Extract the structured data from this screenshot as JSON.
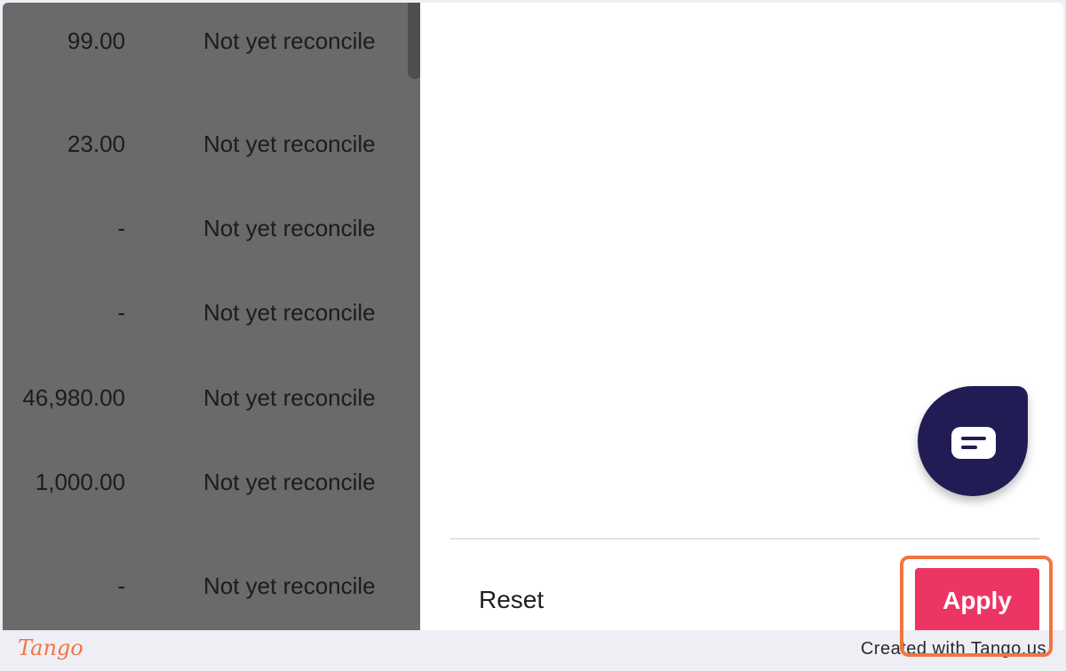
{
  "table": {
    "rows": [
      {
        "amount": "99.00",
        "status": "Not yet reconcile"
      },
      {
        "amount": "23.00",
        "status": "Not yet reconcile"
      },
      {
        "amount": "-",
        "status": "Not yet reconcile"
      },
      {
        "amount": "-",
        "status": "Not yet reconcile"
      },
      {
        "amount": "46,980.00",
        "status": "Not yet reconcile"
      },
      {
        "amount": "1,000.00",
        "status": "Not yet reconcile"
      },
      {
        "amount": "-",
        "status": "Not yet reconcile"
      }
    ]
  },
  "panel": {
    "reset_label": "Reset",
    "apply_label": "Apply",
    "chat_icon": "chat-bubble-icon"
  },
  "footer": {
    "logo": "Tango",
    "credit": "Created with Tango.us"
  },
  "colors": {
    "accent": "#ed3563",
    "highlight": "#f2753e",
    "chat": "#221c54"
  }
}
